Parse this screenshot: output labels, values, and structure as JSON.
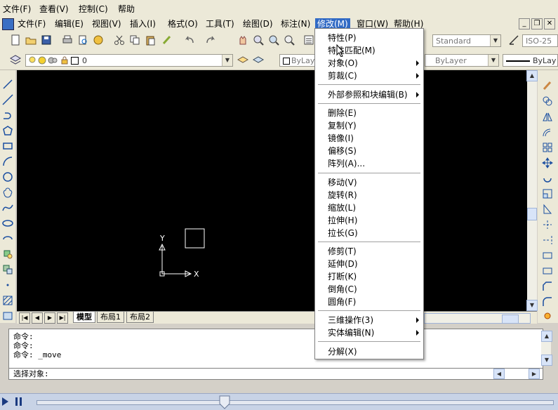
{
  "outer_menu": [
    "文件(F)",
    "查看(V)",
    "控制(C)",
    "帮助"
  ],
  "app_menu": [
    {
      "label": "文件(F)"
    },
    {
      "label": "编辑(E)"
    },
    {
      "label": "视图(V)"
    },
    {
      "label": "插入(I)"
    },
    {
      "label": "格式(O)"
    },
    {
      "label": "工具(T)"
    },
    {
      "label": "绘图(D)"
    },
    {
      "label": "标注(N)"
    },
    {
      "label": "修改(M)",
      "active": true
    },
    {
      "label": "窗口(W)"
    },
    {
      "label": "帮助(H)"
    }
  ],
  "toolbar": {
    "layer_name": "0",
    "text_style": "Standard",
    "dim_style": "ISO-25",
    "color": "ByLayer",
    "linetype": "ByLayer",
    "lineweight": "ByLay"
  },
  "modify_menu": {
    "groups": [
      [
        "特性(P)",
        "特性匹配(M)",
        "对象(O)",
        "剪裁(C)"
      ],
      [
        "外部参照和块编辑(B)"
      ],
      [
        "删除(E)",
        "复制(Y)",
        "镜像(I)",
        "偏移(S)",
        "阵列(A)..."
      ],
      [
        "移动(V)",
        "旋转(R)",
        "缩放(L)",
        "拉伸(H)",
        "拉长(G)"
      ],
      [
        "修剪(T)",
        "延伸(D)",
        "打断(K)",
        "倒角(C)",
        "圆角(F)"
      ],
      [
        "三维操作(3)",
        "实体编辑(N)"
      ],
      [
        "分解(X)"
      ]
    ]
  },
  "ucs": {
    "x_label": "X",
    "y_label": "Y"
  },
  "layout_tabs": [
    "模型",
    "布局1",
    "布局2"
  ],
  "command": {
    "lines": [
      "命令:",
      "命令:",
      "命令: _move"
    ],
    "prompt": "选择对象:"
  }
}
